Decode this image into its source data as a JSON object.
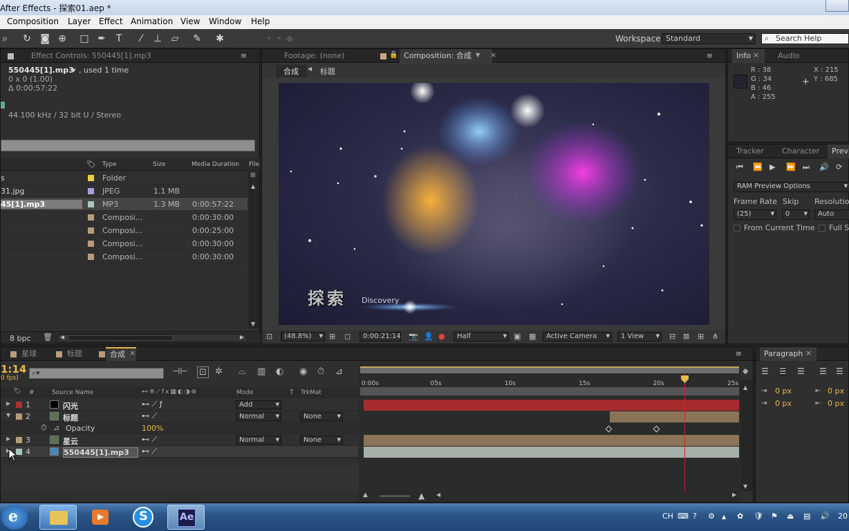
{
  "window": {
    "title": "After Effects - 探索01.aep *"
  },
  "menu": [
    "Composition",
    "Layer",
    "Effect",
    "Animation",
    "View",
    "Window",
    "Help"
  ],
  "toolbar": {
    "workspace_label": "Workspace:",
    "workspace_value": "Standard",
    "search_placeholder": "Search Help",
    "tools": [
      "zoom-icon",
      "rotate-icon",
      "camera-orbit-icon",
      "pan-behind-icon",
      "rectangle-icon",
      "pen-icon",
      "text-icon",
      "brush-icon",
      "clone-stamp-icon",
      "eraser-icon",
      "roto-brush-icon",
      "puppet-pin-icon"
    ]
  },
  "project_panel": {
    "tab": "Effect Controls: 550445[1].mp3",
    "file_name": "550445[1].mp3",
    "used": ", used 1 time",
    "dims": "0 x 0 (1.00)",
    "duration": "Δ 0:00:57:22",
    "audio": "44.100 kHz / 32 bit U / Stereo",
    "columns": [
      "Type",
      "Size",
      "Media Duration",
      "File"
    ],
    "rows": [
      {
        "name": "s",
        "type": "Folder",
        "size": "",
        "duration": "",
        "color": "#e8d03e"
      },
      {
        "name": "31.jpg",
        "type": "JPEG",
        "size": "1.1 MB",
        "duration": "",
        "color": "#a79fd6"
      },
      {
        "name": "45[1].mp3",
        "type": "MP3",
        "size": "1.3 MB",
        "duration": "0:00:57:22",
        "color": "#a9c6c0"
      },
      {
        "name": "",
        "type": "Composi...",
        "size": "",
        "duration": "0:00:30:00",
        "color": "#b99b7e"
      },
      {
        "name": "",
        "type": "Composi...",
        "size": "",
        "duration": "0:00:25:00",
        "color": "#b99b7e"
      },
      {
        "name": "",
        "type": "Composi...",
        "size": "",
        "duration": "0:00:30:00",
        "color": "#b99b7e"
      },
      {
        "name": "",
        "type": "Composi...",
        "size": "",
        "duration": "0:00:30:00",
        "color": "#b99b7e"
      }
    ],
    "bpc": "8 bpc"
  },
  "viewer": {
    "tab_footage": "Footage: (none)",
    "tab_comp": "Composition: 合成",
    "breadcrumb": [
      "合成",
      "标题"
    ],
    "title_text": "探索",
    "subtitle_text": "Discovery",
    "zoom": "(48.8%)",
    "timecode": "0:00:21:14",
    "resolution": "Half",
    "camera": "Active Camera",
    "view": "1 View"
  },
  "info_panel": {
    "tabs": [
      "Info",
      "Audio"
    ],
    "r": "R : 38",
    "g": "G : 34",
    "b": "B : 46",
    "a": "A : 255",
    "x": "X : 215",
    "y": "Y : 685",
    "swatch": "#26222e"
  },
  "preview_panel": {
    "tabs": [
      "Tracker",
      "Character",
      "Prev"
    ],
    "options": "RAM Preview Options",
    "frame_rate_label": "Frame Rate",
    "skip_label": "Skip",
    "resolution_label": "Resolution",
    "frame_rate": "(25)",
    "skip": "0",
    "resolution": "Auto",
    "from_current": "From Current Time",
    "full_screen": "Full S"
  },
  "paragraph_panel": {
    "tab": "Paragraph",
    "px_values": [
      "0 px",
      "0 px",
      "0 px",
      "0 px"
    ]
  },
  "timeline": {
    "tabs": [
      "星球",
      "标题",
      "合成"
    ],
    "tab_colors": [
      "#b99b7e",
      "#b99b7e",
      "#b99b7e"
    ],
    "timecode": "1:14",
    "fps": "0 fps)",
    "columns": {
      "num": "#",
      "source": "Source Name",
      "mode": "Mode",
      "t": "T",
      "trkmat": "TrkMat"
    },
    "ruler": [
      "0:00s",
      "05s",
      "10s",
      "15s",
      "20s",
      "25s"
    ],
    "layers": [
      {
        "num": "1",
        "name": "闪光",
        "label_color": "#b52e31",
        "mode": "Add",
        "trkmat": "",
        "bar_color": "#a62b2d",
        "bar_start": 0.0,
        "icon": "solid"
      },
      {
        "num": "2",
        "name": "标题",
        "label_color": "#b99b7e",
        "mode": "Normal",
        "trkmat": "None",
        "bar_color": "#8a7357",
        "bar_start": 0.654,
        "icon": "comp"
      },
      {
        "num": "3",
        "name": "星云",
        "label_color": "#b99b7e",
        "mode": "Normal",
        "trkmat": "None",
        "bar_color": "#8a7357",
        "bar_start": 0.0,
        "icon": "comp"
      },
      {
        "num": "4",
        "name": "550445[1].mp3",
        "label_color": "#a9c6c0",
        "mode": "",
        "trkmat": "",
        "bar_color": "#a4b0a8",
        "bar_start": 0.0,
        "icon": "audio"
      }
    ],
    "property": {
      "name": "Opacity",
      "value": "100%"
    }
  },
  "taskbar": {
    "tray_lang": "CH",
    "clock": "20"
  }
}
